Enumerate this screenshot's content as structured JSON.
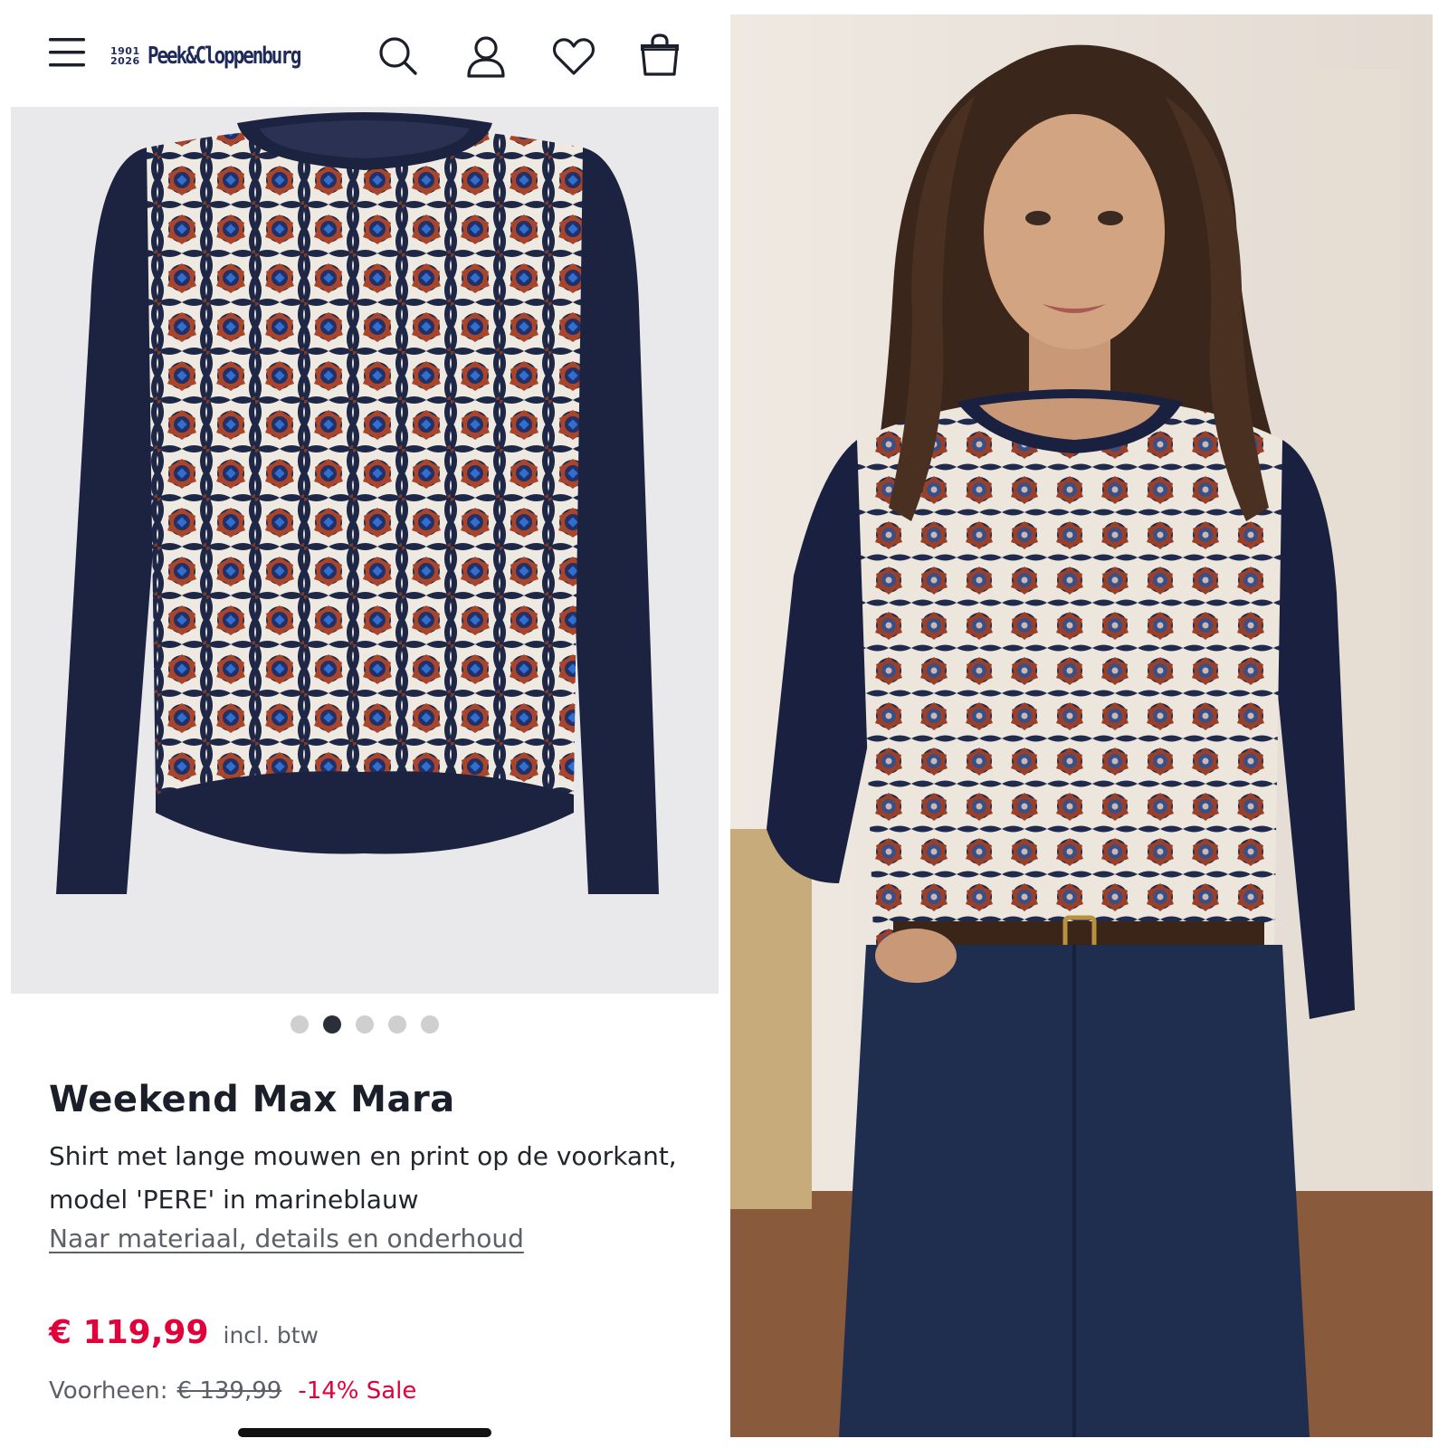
{
  "header": {
    "logo_years_top": "1901",
    "logo_years_bottom": "2026",
    "logo_name": "Peek&Cloppenburg",
    "icons": [
      "menu-icon",
      "search-icon",
      "user-icon",
      "heart-icon",
      "bag-icon"
    ]
  },
  "gallery": {
    "slide_count": 5,
    "active_index": 1
  },
  "product": {
    "brand": "Weekend Max Mara",
    "description": "Shirt met lange mouwen en print op de voorkant, model 'PERE' in marineblauw",
    "details_link": "Naar materiaal, details en onderhoud",
    "price": "€ 119,99",
    "vat_note": "incl. btw",
    "previous_label": "Voorheen:",
    "previous_price": "€ 139,99",
    "discount": "-14% Sale"
  },
  "colors": {
    "brand_navy": "#1d2a5a",
    "price_red": "#e2003b",
    "shirt_navy": "#1c2340",
    "print_rust": "#a8452a",
    "print_blue": "#2f6fd0",
    "print_cream": "#f1ece4",
    "image_bg": "#e9e9eb"
  }
}
